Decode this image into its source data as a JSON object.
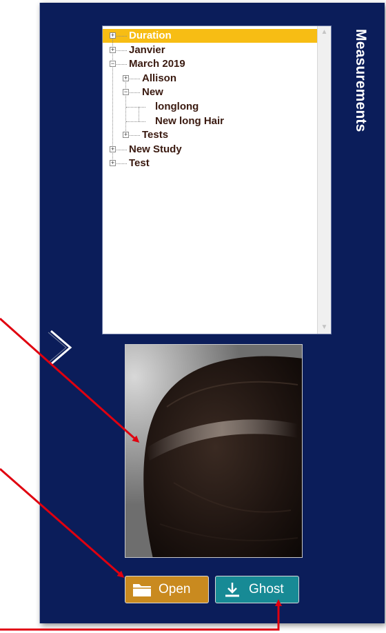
{
  "panel": {
    "title": "Measurements"
  },
  "tree": {
    "items": [
      {
        "label": "Duration",
        "level": 0,
        "expander": "+",
        "selected": true
      },
      {
        "label": "Janvier",
        "level": 0,
        "expander": "+"
      },
      {
        "label": "March 2019",
        "level": 0,
        "expander": "−"
      },
      {
        "label": "Allison",
        "level": 1,
        "expander": "+"
      },
      {
        "label": "New",
        "level": 1,
        "expander": "−"
      },
      {
        "label": "longlong",
        "level": 2,
        "expander": ""
      },
      {
        "label": "New long Hair",
        "level": 2,
        "expander": ""
      },
      {
        "label": "Tests",
        "level": 1,
        "expander": "+"
      },
      {
        "label": "New Study",
        "level": 0,
        "expander": "+"
      },
      {
        "label": "Test",
        "level": 0,
        "expander": "+"
      }
    ],
    "scroll_up_icon": "triangle-up-icon",
    "scroll_down_icon": "triangle-down-icon"
  },
  "chevron_icon": "chevron-right-icon",
  "buttons": {
    "open_label": "Open",
    "open_icon": "folder-icon",
    "open_color": "#c98a1f",
    "ghost_label": "Ghost",
    "ghost_icon": "download-icon",
    "ghost_color": "#178a95"
  },
  "colors": {
    "panel_bg": "#0b1d5a",
    "selection": "#f7bd14",
    "annotation_arrow": "#e0000f"
  }
}
